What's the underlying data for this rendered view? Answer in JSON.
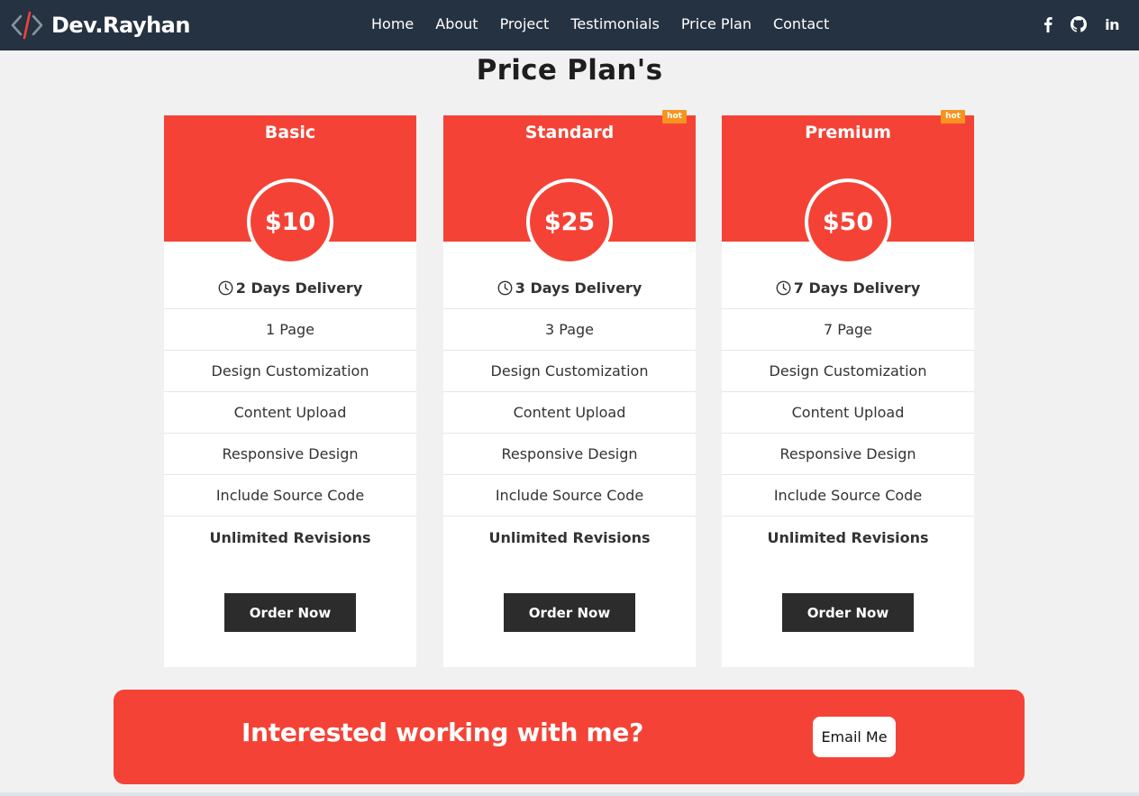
{
  "brand": {
    "name": "Dev.Rayhan",
    "icon": "code-brackets-icon"
  },
  "nav": {
    "links": [
      "Home",
      "About",
      "Project",
      "Testimonials",
      "Price Plan",
      "Contact"
    ]
  },
  "social": {
    "facebook": "facebook-icon",
    "github": "github-icon",
    "linkedin_label": "in"
  },
  "section_title": "Price Plan's",
  "plans": [
    {
      "name": "Basic",
      "price": "$10",
      "hot": "",
      "delivery": "2 Days Delivery",
      "features": [
        "1 Page",
        "Design Customization",
        "Content Upload",
        "Responsive Design",
        "Include Source Code",
        "Unlimited Revisions"
      ],
      "order_label": "Order Now"
    },
    {
      "name": "Standard",
      "price": "$25",
      "hot": "hot",
      "delivery": "3 Days Delivery",
      "features": [
        "3 Page",
        "Design Customization",
        "Content Upload",
        "Responsive Design",
        "Include Source Code",
        "Unlimited Revisions"
      ],
      "order_label": "Order Now"
    },
    {
      "name": "Premium",
      "price": "$50",
      "hot": "hot",
      "delivery": "7 Days Delivery",
      "features": [
        "7 Page",
        "Design Customization",
        "Content Upload",
        "Responsive Design",
        "Include Source Code",
        "Unlimited Revisions"
      ],
      "order_label": "Order Now"
    }
  ],
  "cta": {
    "text": "Interested working with me?",
    "button_label": "Email Me"
  },
  "colors": {
    "nav_bg": "#253241",
    "accent": "#f44336",
    "badge": "#f7931e",
    "button_dark": "#2c2c2c",
    "page_bg": "#f1f1f1"
  }
}
